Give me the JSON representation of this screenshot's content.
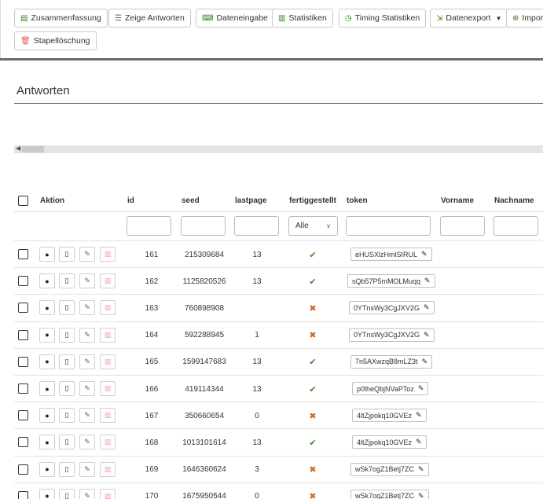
{
  "toolbar": {
    "buttons": [
      {
        "label": "Zusammenfassung",
        "icon": "list-alt-icon"
      },
      {
        "label": "Zeige Antworten",
        "icon": "list-icon"
      },
      {
        "label": "Dateneingabe",
        "icon": "keyboard-icon"
      },
      {
        "label": "Statistiken",
        "icon": "bar-chart-icon"
      },
      {
        "label": "Timing Statistiken",
        "icon": "clock-icon"
      },
      {
        "label": "Datenexport",
        "icon": "export-icon",
        "has_dropdown": true
      },
      {
        "label": "Impor",
        "icon": "import-icon"
      },
      {
        "label": "Stapellöschung",
        "icon": "trash-icon"
      }
    ]
  },
  "page": {
    "heading": "Antworten"
  },
  "table": {
    "columns": {
      "aktion": "Aktion",
      "id": "id",
      "seed": "seed",
      "lastpage": "lastpage",
      "fertiggestellt": "fertiggestellt",
      "token": "token",
      "vorname": "Vorname",
      "nachname": "Nachname"
    },
    "filter_select": "Alle",
    "rows": [
      {
        "id": "161",
        "seed": "215309684",
        "lastpage": "13",
        "done": true,
        "token": "eHUSXlzHmlSIRUL"
      },
      {
        "id": "162",
        "seed": "1125820526",
        "lastpage": "13",
        "done": true,
        "token": "sQb57P5mMOLMuqq"
      },
      {
        "id": "163",
        "seed": "760898908",
        "lastpage": "",
        "done": false,
        "token": "0YTnsWy3CgJXV2G"
      },
      {
        "id": "164",
        "seed": "592288945",
        "lastpage": "1",
        "done": false,
        "token": "0YTnsWy3CgJXV2G"
      },
      {
        "id": "165",
        "seed": "1599147683",
        "lastpage": "13",
        "done": true,
        "token": "7n5AXwzqB8mLZ3t"
      },
      {
        "id": "166",
        "seed": "419114344",
        "lastpage": "13",
        "done": true,
        "token": "p0lheQbjNVaPToz"
      },
      {
        "id": "167",
        "seed": "350660654",
        "lastpage": "0",
        "done": false,
        "token": "4ltZjpokq10GVEz"
      },
      {
        "id": "168",
        "seed": "1013101614",
        "lastpage": "13",
        "done": true,
        "token": "4ltZjpokq10GVEz"
      },
      {
        "id": "169",
        "seed": "1646360624",
        "lastpage": "3",
        "done": false,
        "token": "wSk7ogZ1Betj7ZC"
      },
      {
        "id": "170",
        "seed": "1675950544",
        "lastpage": "0",
        "done": false,
        "token": "wSk7ogZ1Betj7ZC"
      }
    ]
  },
  "colors": {
    "accent": "#2f7d32",
    "done": "#3b8a2b",
    "not_done": "#d0661e"
  }
}
